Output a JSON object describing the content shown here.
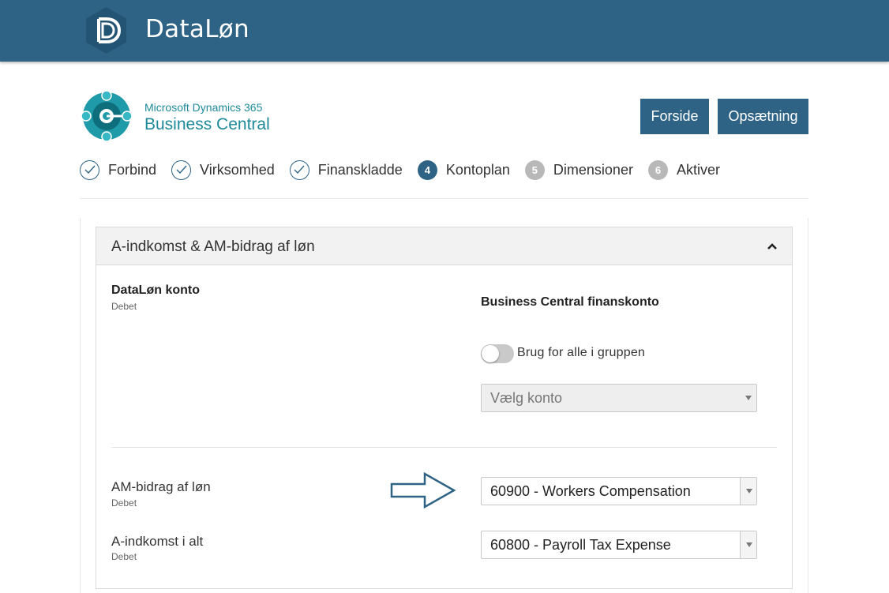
{
  "header": {
    "app_title": "DataLøn",
    "logo_icon": "dataloen-d-logo"
  },
  "brand": {
    "line1": "Microsoft Dynamics 365",
    "line2": "Business Central"
  },
  "actions": {
    "forside_label": "Forside",
    "opsaetning_label": "Opsætning"
  },
  "steps": [
    {
      "label": "Forbind",
      "marker": "",
      "state": "done"
    },
    {
      "label": "Virksomhed",
      "marker": "",
      "state": "done"
    },
    {
      "label": "Finanskladde",
      "marker": "",
      "state": "done"
    },
    {
      "label": "Kontoplan",
      "marker": "4",
      "state": "active"
    },
    {
      "label": "Dimensioner",
      "marker": "5",
      "state": "todo"
    },
    {
      "label": "Aktiver",
      "marker": "6",
      "state": "todo"
    }
  ],
  "section": {
    "title": "A-indkomst & AM-bidrag af løn",
    "col_left_heading": "DataLøn konto",
    "col_left_sub": "Debet",
    "col_right_heading": "Business Central finanskonto",
    "toggle_label": "Brug for alle i gruppen",
    "toggle_on": false,
    "group_select_placeholder": "Vælg konto",
    "rows": [
      {
        "name": "AM-bidrag af løn",
        "side": "Debet",
        "account": "60900 - Workers Compensation"
      },
      {
        "name": "A-indkomst i alt",
        "side": "Debet",
        "account": "60800 - Payroll Tax Expense"
      }
    ]
  },
  "colors": {
    "primary": "#2e6386",
    "brand_teal": "#1f8a9a",
    "inactive_step": "#b8b8b8"
  }
}
